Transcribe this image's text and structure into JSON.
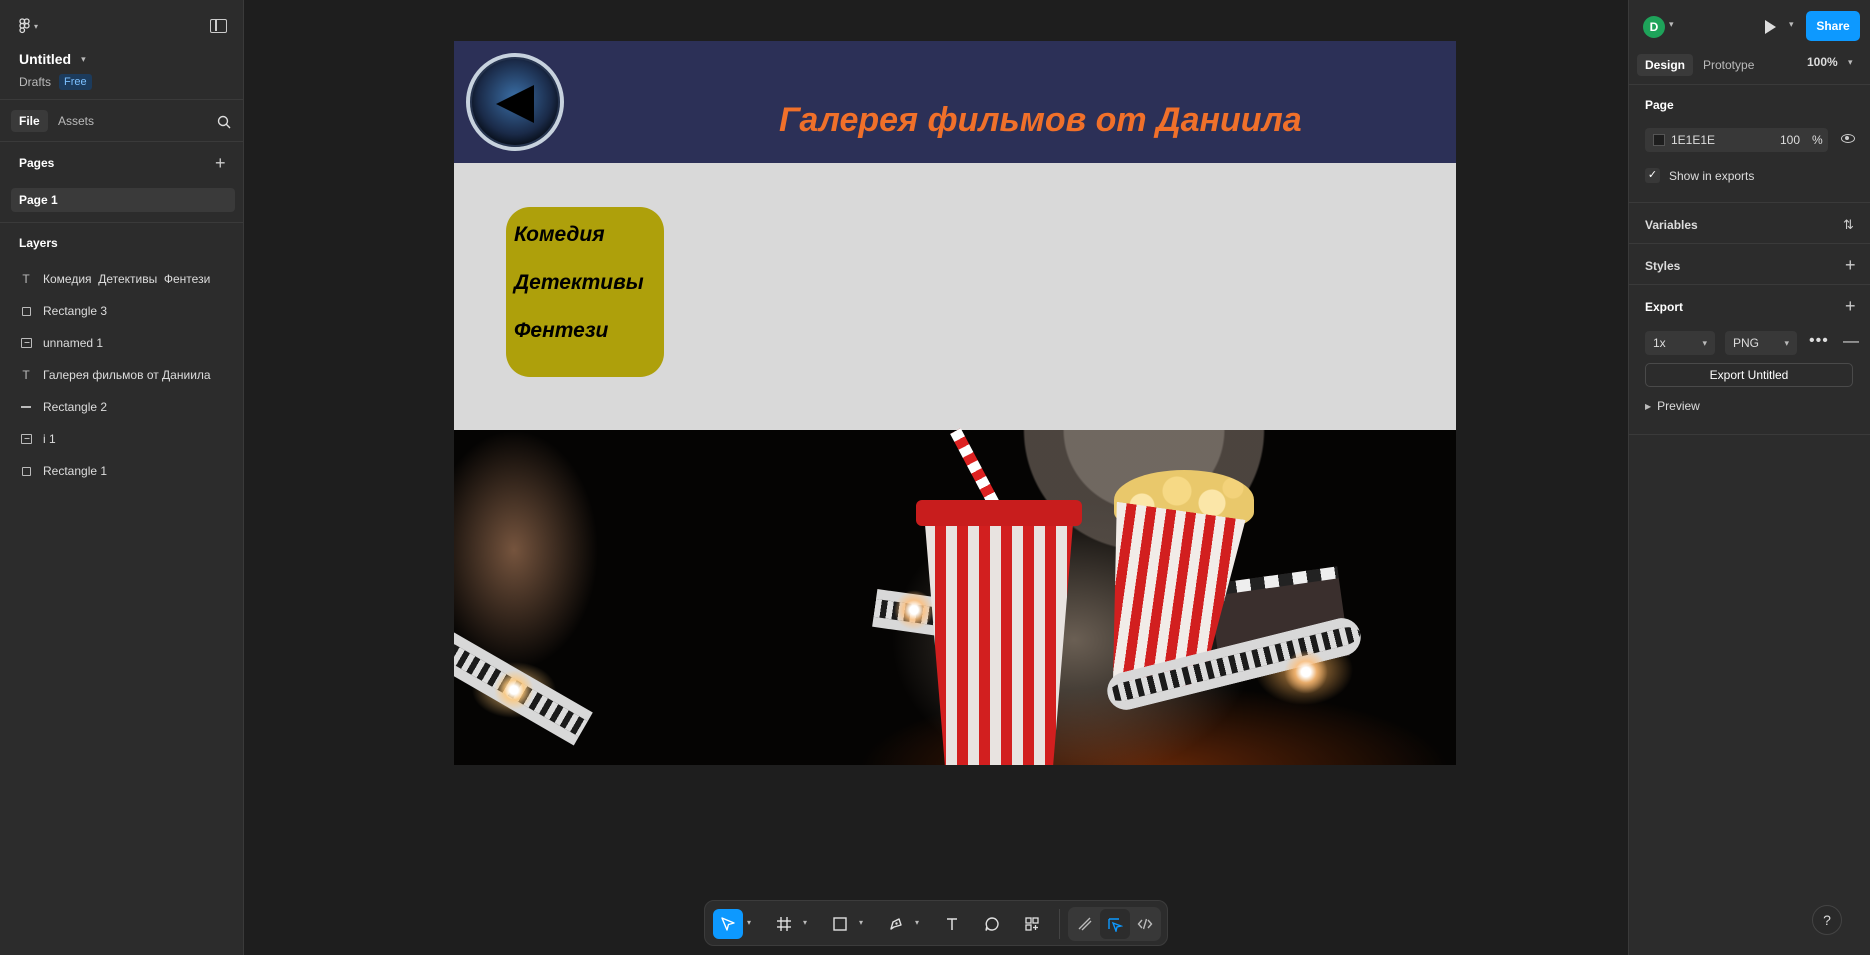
{
  "file": {
    "title": "Untitled",
    "location": "Drafts",
    "plan_badge": "Free"
  },
  "left_tabs": [
    "File",
    "Assets"
  ],
  "pages": {
    "heading": "Pages",
    "items": [
      "Page 1"
    ]
  },
  "layers": {
    "heading": "Layers",
    "items": [
      {
        "type": "text",
        "name": "Комедия  Детективы  Фентези"
      },
      {
        "type": "rect",
        "name": "Rectangle 3"
      },
      {
        "type": "image",
        "name": "unnamed 1"
      },
      {
        "type": "text",
        "name": "Галерея фильмов от Даниила"
      },
      {
        "type": "line",
        "name": "Rectangle 2"
      },
      {
        "type": "image",
        "name": "i 1"
      },
      {
        "type": "rect",
        "name": "Rectangle 1"
      }
    ]
  },
  "canvas": {
    "title": "Галерея фильмов от Даниила",
    "menu": [
      "Комедия",
      "Детективы",
      "Фентези"
    ],
    "colors": {
      "header_bg": "#2c3057",
      "title": "#f0702a",
      "menu_bg": "#aea00b",
      "frame_bg": "#d9d9d9"
    }
  },
  "right": {
    "avatar_initial": "D",
    "share_label": "Share",
    "tabs": [
      "Design",
      "Prototype"
    ],
    "zoom": "100%",
    "page_section": {
      "heading": "Page",
      "color_hex": "1E1E1E",
      "opacity": "100",
      "unit": "%",
      "show_in_exports": "Show in exports"
    },
    "variables_heading": "Variables",
    "styles_heading": "Styles",
    "export": {
      "heading": "Export",
      "scale": "1x",
      "format": "PNG",
      "button": "Export Untitled",
      "preview": "Preview"
    },
    "help": "?"
  },
  "icons": [
    "figma-menu-icon",
    "sidebar-toggle-icon",
    "search-icon",
    "plus-icon",
    "text-layer-icon",
    "rectangle-layer-icon",
    "image-layer-icon",
    "line-layer-icon",
    "play-icon",
    "eye-icon",
    "variables-icon",
    "move-tool-icon",
    "frame-tool-icon",
    "shape-tool-icon",
    "pen-tool-icon",
    "text-tool-icon",
    "comment-tool-icon",
    "actions-icon",
    "draw-mode-icon",
    "design-mode-icon",
    "dev-mode-icon"
  ]
}
